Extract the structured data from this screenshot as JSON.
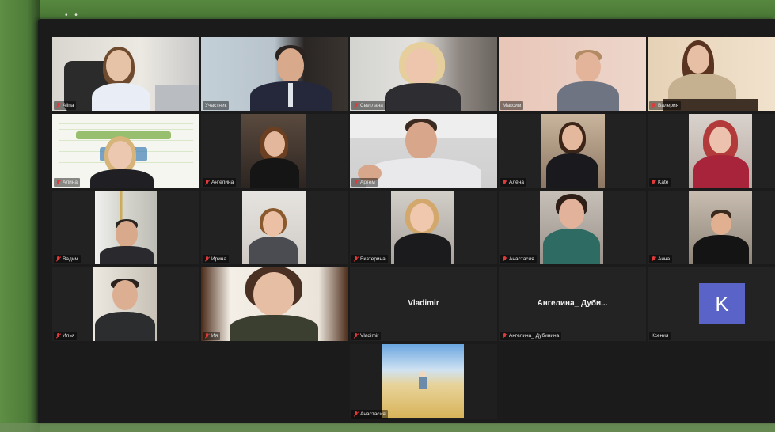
{
  "meeting": {
    "colors": {
      "active_speaker": "#c9dd3c",
      "muted_mic": "#e13a3a",
      "avatar_bg": "#5a64c8"
    },
    "participants": [
      {
        "name": "Alina",
        "video": true
      },
      {
        "name": "Участник",
        "video": true,
        "active": true
      },
      {
        "name": "Светлана",
        "video": true
      },
      {
        "name": "Максим",
        "video": true
      },
      {
        "name": "Валерия",
        "video": true
      },
      {
        "name": "Алина",
        "video": true
      },
      {
        "name": "Ангелина",
        "video": true
      },
      {
        "name": "Артём",
        "video": true
      },
      {
        "name": "Алёна",
        "video": true
      },
      {
        "name": "Kate",
        "video": true
      },
      {
        "name": "Вадим",
        "video": true
      },
      {
        "name": "Ирина",
        "video": true
      },
      {
        "name": "Екатерина",
        "video": true
      },
      {
        "name": "Анастасия",
        "video": true
      },
      {
        "name": "Анна",
        "video": true
      },
      {
        "name": "Илья",
        "video": true
      },
      {
        "name": "Ия",
        "video": true
      },
      {
        "name": "Vladimir",
        "display": "Vladimir",
        "video": false
      },
      {
        "name": "Ангелина_ Дубинина",
        "display": "Ангелина_ Дуби...",
        "video": false
      },
      {
        "name": "Ксения",
        "video": false,
        "avatar_letter": "K"
      },
      {
        "name": "Анастасия",
        "video": true
      }
    ]
  }
}
